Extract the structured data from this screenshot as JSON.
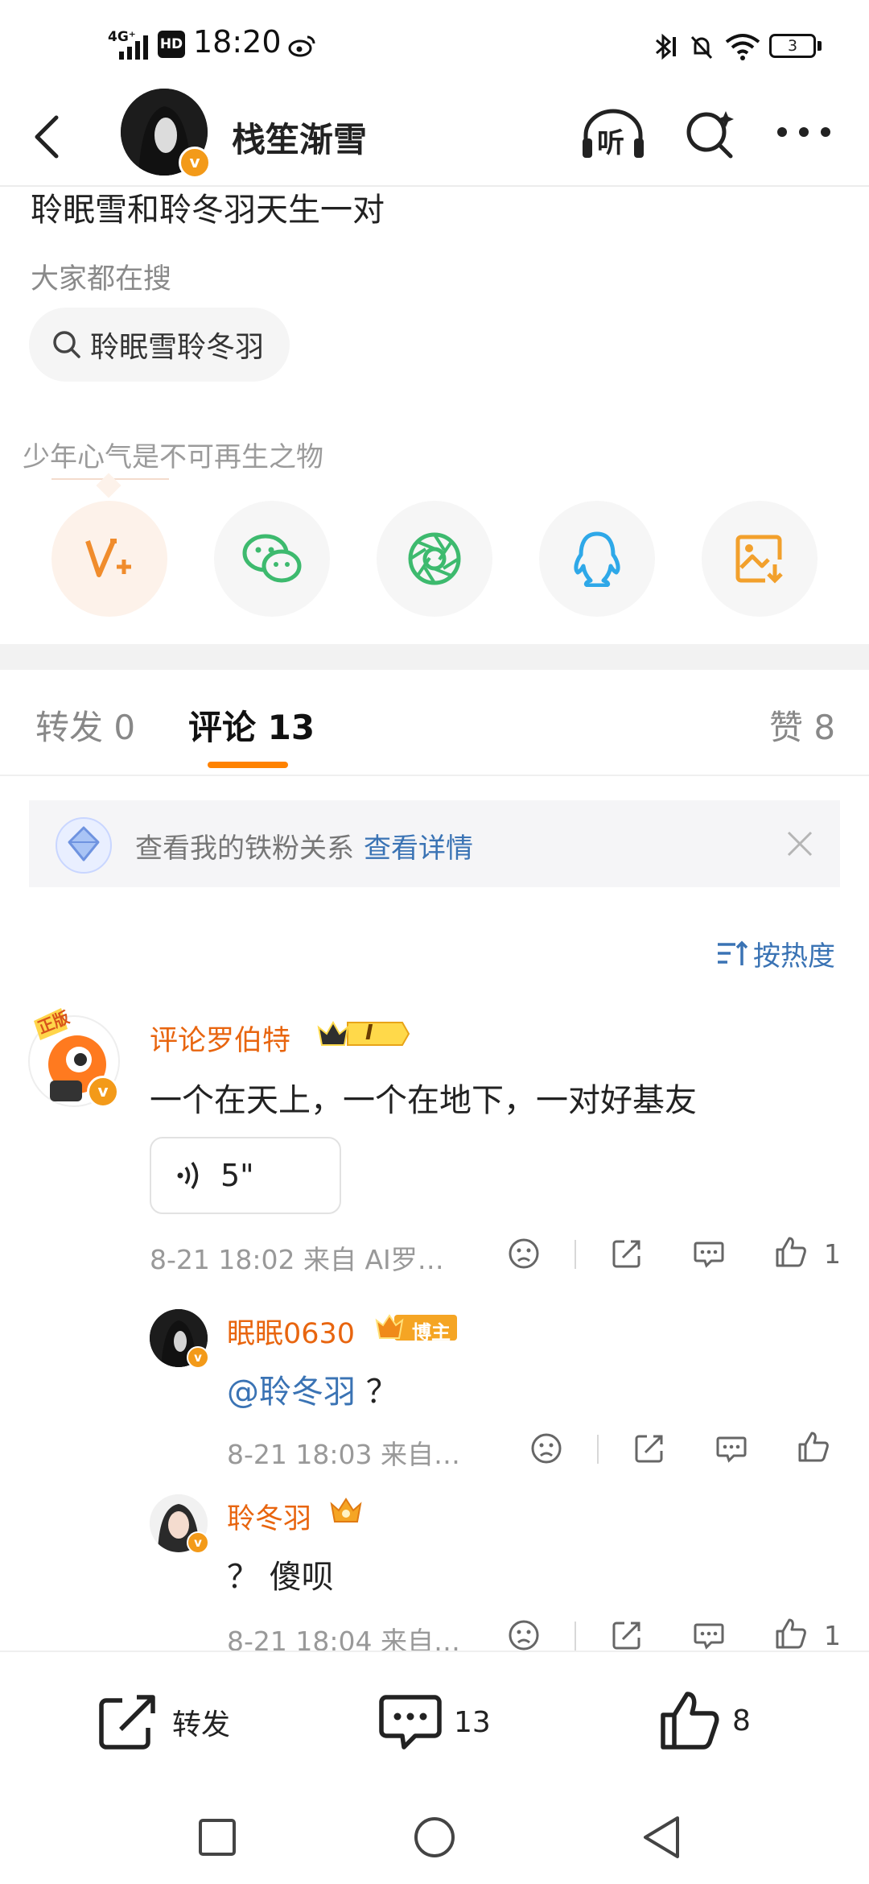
{
  "status_bar": {
    "network": "4G⁺",
    "hd": "HD",
    "time": "18:20",
    "battery": "3"
  },
  "header": {
    "title": "栈笙渐雪",
    "listen_label": "听"
  },
  "post": {
    "text": "聆眠雪和聆冬羽天生一对",
    "trend_label": "大家都在搜",
    "trend_chip": "聆眠雪聆冬羽",
    "slogan": "少年心气是不可再生之物"
  },
  "share_icons": [
    "vplus-icon",
    "wechat-icon",
    "moments-icon",
    "qq-icon",
    "save-image-icon"
  ],
  "tabs": {
    "repost": "转发 0",
    "comments": "评论 13",
    "likes": "赞 8"
  },
  "fan_banner": {
    "text": "查看我的铁粉关系",
    "link": "查看详情"
  },
  "sort_label": "按热度",
  "comments": [
    {
      "name": "评论罗伯特",
      "badge_level": "I",
      "avatar_label": "正版",
      "text": "一个在天上，一个在地下，一对好基友",
      "voice_duration": "5\"",
      "meta": "8-21 18:02  来自 AI罗…",
      "like_count": "1"
    }
  ],
  "replies": [
    {
      "name": "眠眠0630",
      "badge": "博主",
      "text_mention": "@聆冬羽",
      "text_rest": " ？",
      "meta": "8-21 18:03  来自…",
      "like_count": ""
    },
    {
      "name": "聆冬羽",
      "text": "？ 傻呗",
      "meta": "8-21 18:04  来自…",
      "like_count": "1"
    }
  ],
  "bottom_bar": {
    "repost": "转发",
    "comments": "13",
    "likes": "8"
  },
  "colors": {
    "accent": "#ff8200",
    "link": "#3a73b4",
    "name": "#e8650f"
  }
}
